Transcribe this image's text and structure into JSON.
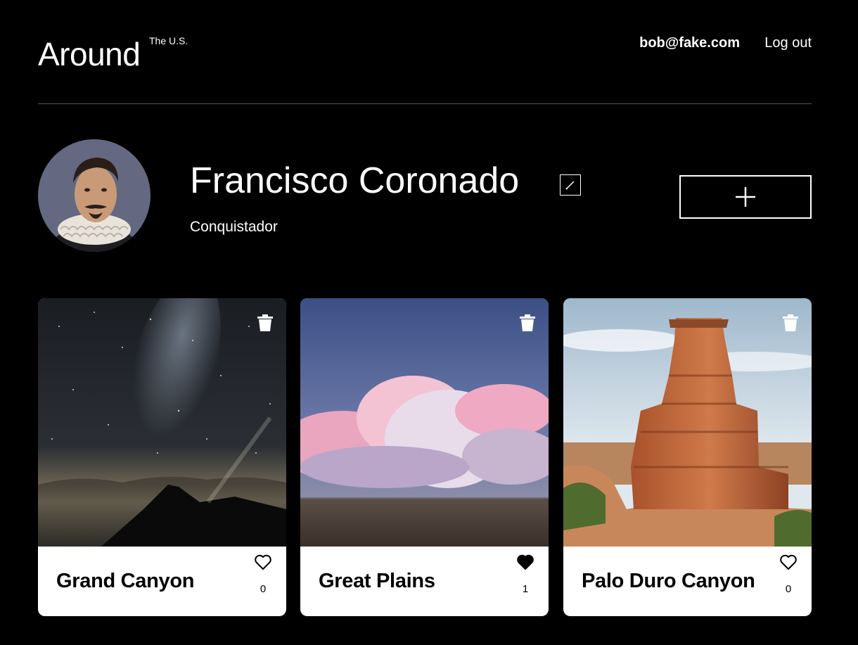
{
  "header": {
    "logo": "Around",
    "logo_superscript": "The U.S.",
    "user_email": "bob@fake.com",
    "logout_label": "Log out"
  },
  "profile": {
    "name": "Francisco Coronado",
    "about": "Conquistador",
    "edit_icon": "pencil-icon",
    "add_icon": "plus-icon"
  },
  "cards": [
    {
      "title": "Grand Canyon",
      "likes": "0",
      "liked": false,
      "image": "night-sky-milky-way-mountain"
    },
    {
      "title": "Great Plains",
      "likes": "1",
      "liked": true,
      "image": "pink-cloud-over-grassland"
    },
    {
      "title": "Palo Duro Canyon",
      "likes": "0",
      "liked": false,
      "image": "red-rock-lighthouse-formation"
    }
  ],
  "colors": {
    "background": "#000000",
    "card_background": "#ffffff",
    "divider": "#545454",
    "text": "#ffffff"
  }
}
